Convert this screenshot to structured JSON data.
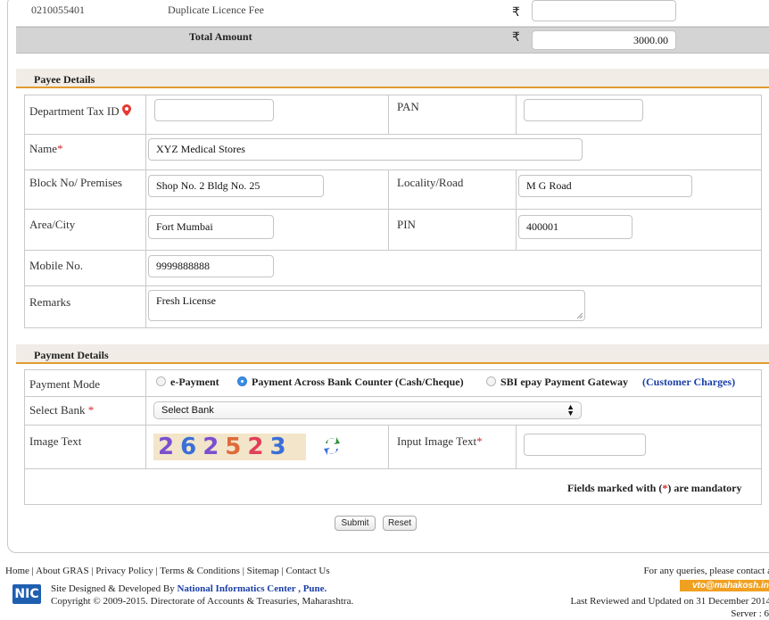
{
  "fees": {
    "top_row": {
      "code": "0210055401",
      "label": "Duplicate Licence Fee",
      "currency": "₹",
      "value": ""
    },
    "total": {
      "label": "Total Amount",
      "currency": "₹",
      "value": "3000.00"
    }
  },
  "payee": {
    "section_title": "Payee Details",
    "dept_tax_id_label": "Department Tax ID",
    "dept_tax_id_value": "",
    "pan_label": "PAN",
    "pan_value": "",
    "name_label": "Name",
    "name_value": "XYZ Medical Stores",
    "block_label": "Block No/ Premises",
    "block_value": "Shop No. 2 Bldg No. 25",
    "locality_label": "Locality/Road",
    "locality_value": "M G Road",
    "area_label": "Area/City",
    "area_value": "Fort Mumbai",
    "pin_label": "PIN",
    "pin_value": "400001",
    "mobile_label": "Mobile No.",
    "mobile_value": "9999888888",
    "remarks_label": "Remarks",
    "remarks_value": "Fresh License"
  },
  "payment": {
    "section_title": "Payment Details",
    "mode_label": "Payment Mode",
    "options": [
      "e-Payment",
      "Payment Across Bank Counter (Cash/Cheque)",
      "SBI epay Payment Gateway"
    ],
    "selected_option": 1,
    "customer_charges_link": "Customer Charges",
    "bank_label": "Select Bank",
    "bank_value": "Select Bank",
    "image_text_label": "Image Text",
    "captcha": "262523",
    "input_image_label": "Input Image Text",
    "input_image_value": "",
    "mandatory_note_pre": "Fields marked with (",
    "mandatory_note_star": "*",
    "mandatory_note_post": ") are mandatory"
  },
  "buttons": {
    "submit": "Submit",
    "reset": "Reset"
  },
  "footer": {
    "links": [
      "Home",
      "About GRAS",
      "Privacy Policy",
      "Terms & Conditions",
      "Sitemap",
      "Contact Us"
    ],
    "nic_logo": "NIC",
    "designed_by_pre": "Site Designed & Developed By ",
    "designed_by_org": "National Informatics Center , Pune.",
    "copyright": "Copyright © 2009-2015. Directorate of Accounts & Treasuries, Maharashtra.",
    "queries": "For any queries, please contact a",
    "email": "vto@mahakosh.in",
    "reviewed": "Last Reviewed and Updated on 31 December 2014",
    "server": "Server : 6"
  },
  "colors": {
    "accent": "#e29a2f",
    "link": "#1a3ea8",
    "mandatory": "#d62828",
    "radio_on": "#3a8ee6"
  }
}
